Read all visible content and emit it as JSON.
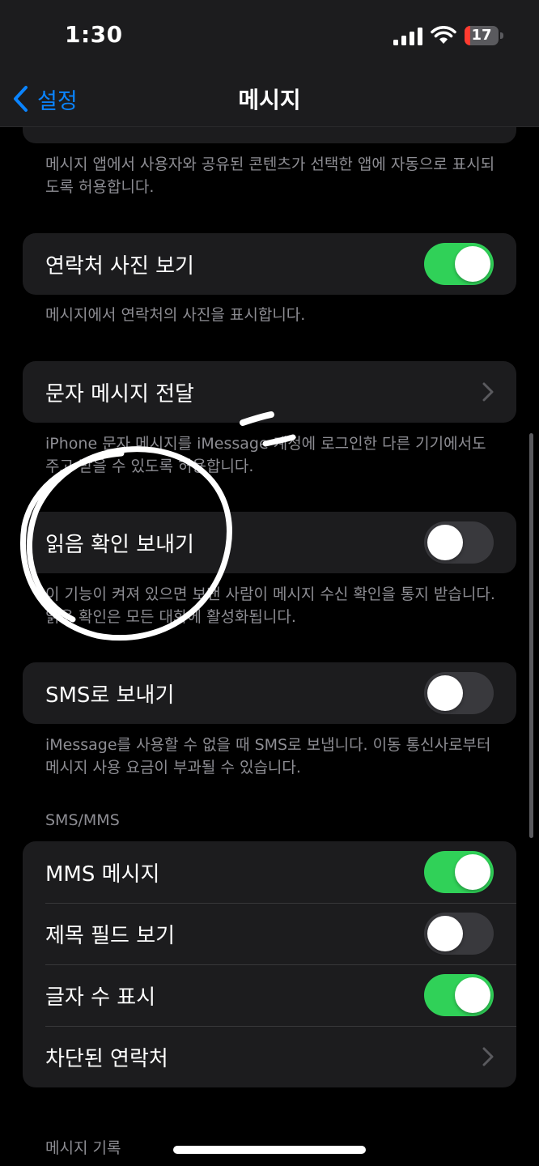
{
  "status_bar": {
    "time": "1:30",
    "battery_level": "17",
    "icons": [
      "cellular-signal-icon",
      "wifi-icon",
      "battery-icon"
    ]
  },
  "nav": {
    "back_label": "설정",
    "title": "메시지"
  },
  "sections": {
    "shared_footer": "메시지 앱에서 사용자와 공유된 콘텐츠가 선택한 앱에 자동으로 표시되도록 허용합니다.",
    "contact_photos": {
      "label": "연락처 사진 보기",
      "on": true
    },
    "contact_photos_footer": "메시지에서 연락처의 사진을 표시합니다.",
    "text_forwarding": {
      "label": "문자 메시지 전달"
    },
    "text_forwarding_footer": "iPhone 문자 메시지를 iMessage 계정에 로그인한 다른 기기에서도 주고 받을 수 있도록 허용합니다.",
    "read_receipts": {
      "label": "읽음 확인 보내기",
      "on": false
    },
    "read_receipts_footer": "이 기능이 켜져 있으면 보낸 사람이 메시지 수신 확인을 통지 받습니다. 읽음 확인은 모든 대화에 활성화됩니다.",
    "send_as_sms": {
      "label": "SMS로 보내기",
      "on": false
    },
    "send_as_sms_footer": "iMessage를 사용할 수 없을 때 SMS로 보냅니다. 이동 통신사로부터 메시지 사용 요금이 부과될 수 있습니다.",
    "sms_mms_header": "SMS/MMS",
    "mms_messaging": {
      "label": "MMS 메시지",
      "on": true
    },
    "show_subject": {
      "label": "제목 필드 보기",
      "on": false
    },
    "char_count": {
      "label": "글자 수 표시",
      "on": true
    },
    "blocked": {
      "label": "차단된 연락처"
    },
    "history_header": "메시지 기록"
  },
  "colors": {
    "accent": "#0a84ff",
    "toggle_on": "#30d158",
    "toggle_off": "#39393d",
    "cell_bg": "#1c1c1e",
    "footnote": "#8d8d93",
    "battery_low": "#ff3b30"
  }
}
